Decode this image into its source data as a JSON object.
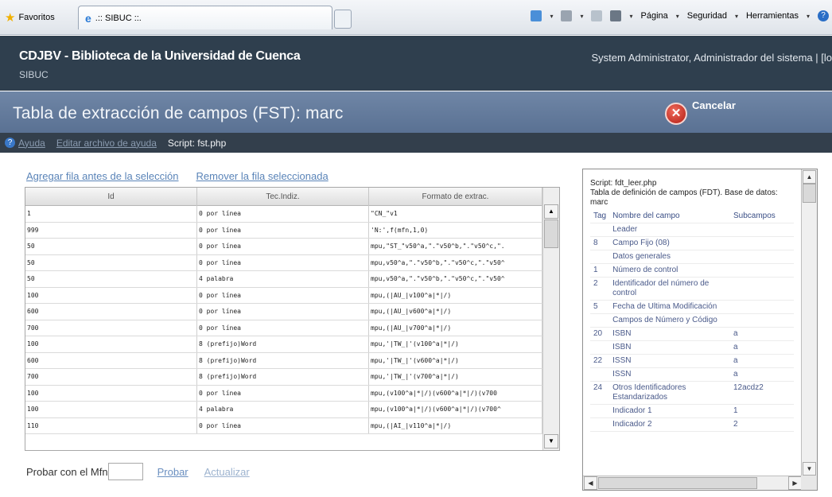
{
  "browser": {
    "favorites_label": "Favoritos",
    "tab_title": ".:: SIBUC ::.",
    "commands": [
      "Página",
      "Seguridad",
      "Herramientas"
    ]
  },
  "header": {
    "org_name": "CDJBV - Biblioteca de la Universidad de Cuenca",
    "system_name": "SIBUC",
    "user_info": "System Administrator, Administrador del sistema | [lo"
  },
  "titlebar": {
    "title": "Tabla de extracción de campos (FST): marc",
    "cancel_label": "Cancelar"
  },
  "subbar": {
    "help_label": "Ayuda",
    "edit_help_label": "Editar archivo de ayuda",
    "script_label": "Script: fst.php"
  },
  "actions": {
    "add_row_label": "Agregar fila antes de la selección",
    "remove_row_label": "Remover la fila seleccionada"
  },
  "grid": {
    "columns": [
      "Id",
      "Tec.Indiz.",
      "Formato de extrac."
    ],
    "rows": [
      [
        "1",
        "0 por línea",
        "\"CN_\"v1"
      ],
      [
        "999",
        "0 por línea",
        "'N:',f(mfn,1,0)"
      ],
      [
        "50",
        "0 por línea",
        "mpu,\"ST_\"v50^a,\".\"v50^b,\".\"v50^c,\"."
      ],
      [
        "50",
        "0 por línea",
        "mpu,v50^a,\".\"v50^b,\".\"v50^c,\".\"v50^"
      ],
      [
        "50",
        "4 palabra",
        "mpu,v50^a,\".\"v50^b,\".\"v50^c,\".\"v50^"
      ],
      [
        "100",
        "0 por línea",
        "mpu,(|AU_|v100^a|*|/)"
      ],
      [
        "600",
        "0 por línea",
        "mpu,(|AU_|v600^a|*|/)"
      ],
      [
        "700",
        "0 por línea",
        "mpu,(|AU_|v700^a|*|/)"
      ],
      [
        "100",
        "8 (prefijo)Word",
        "mpu,'|TW_|'(v100^a|*|/)"
      ],
      [
        "600",
        "8 (prefijo)Word",
        "mpu,'|TW_|'(v600^a|*|/)"
      ],
      [
        "700",
        "8 (prefijo)Word",
        "mpu,'|TW_|'(v700^a|*|/)"
      ],
      [
        "100",
        "0 por línea",
        "mpu,(v100^a|*|/)(v600^a|*|/)(v700"
      ],
      [
        "100",
        "4 palabra",
        "mpu,(v100^a|*|/)(v600^a|*|/)(v700^"
      ],
      [
        "110",
        "0 por línea",
        "mpu,(|AI_|v110^a|*|/)"
      ]
    ]
  },
  "test": {
    "label": "Probar con el Mfn",
    "input_value": "",
    "probar_label": "Probar",
    "actualizar_label": "Actualizar"
  },
  "fdt_panel": {
    "script_line": "Script: fdt_leer.php",
    "table_line": "Tabla de definición de campos (FDT). Base de datos: marc",
    "headers": [
      "Tag",
      "Nombre del campo",
      "Subcampos"
    ],
    "rows": [
      [
        "",
        "Leader",
        ""
      ],
      [
        "8",
        "Campo Fijo (08)",
        ""
      ],
      [
        "",
        "Datos generales",
        ""
      ],
      [
        "1",
        "Número de control",
        ""
      ],
      [
        "2",
        "Identificador del número de control",
        ""
      ],
      [
        "5",
        "Fecha de Ultima Modificación",
        ""
      ],
      [
        "",
        "Campos de Número y Código",
        ""
      ],
      [
        "20",
        "ISBN",
        "a"
      ],
      [
        "",
        "ISBN",
        "a"
      ],
      [
        "22",
        "ISSN",
        "a"
      ],
      [
        "",
        "ISSN",
        "a"
      ],
      [
        "24",
        "Otros Identificadores Estandarizados",
        "12acdz2"
      ],
      [
        "",
        "Indicador 1",
        "1"
      ],
      [
        "",
        "Indicador 2",
        "2"
      ]
    ]
  },
  "icons": {
    "favorites": "star-icon",
    "cancel": "close-circle-icon",
    "help": "help-icon"
  },
  "colors": {
    "header_bg": "#2f3f4e",
    "titlebar_bg": "#5f7698",
    "subbar_bg": "#333f4c",
    "link": "#5a84b8",
    "cancel_red": "#c0281c"
  }
}
